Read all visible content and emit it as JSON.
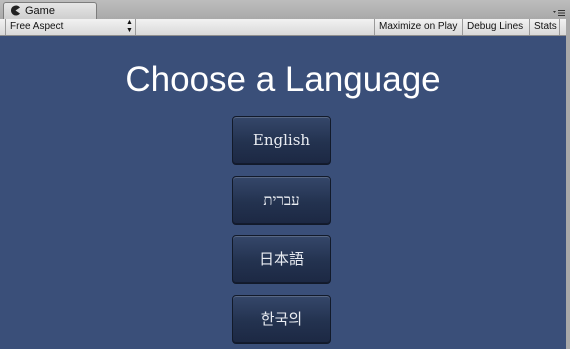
{
  "window": {
    "tab_label": "Game",
    "tab_icon": "pacman-game-icon",
    "panel_menu_icon": "panel-menu-icon"
  },
  "toolbar": {
    "aspect_label": "Free Aspect",
    "maximize_label": "Maximize on Play",
    "debug_label": "Debug Lines",
    "stats_label": "Stats"
  },
  "game": {
    "title": "Choose a Language",
    "languages": [
      {
        "label": "English"
      },
      {
        "label": "עברית"
      },
      {
        "label": "日本語"
      },
      {
        "label": "한국의"
      }
    ]
  },
  "colors": {
    "game_background": "#3a4f79",
    "button_fill": "#23324f",
    "title_text": "#ffffff"
  }
}
